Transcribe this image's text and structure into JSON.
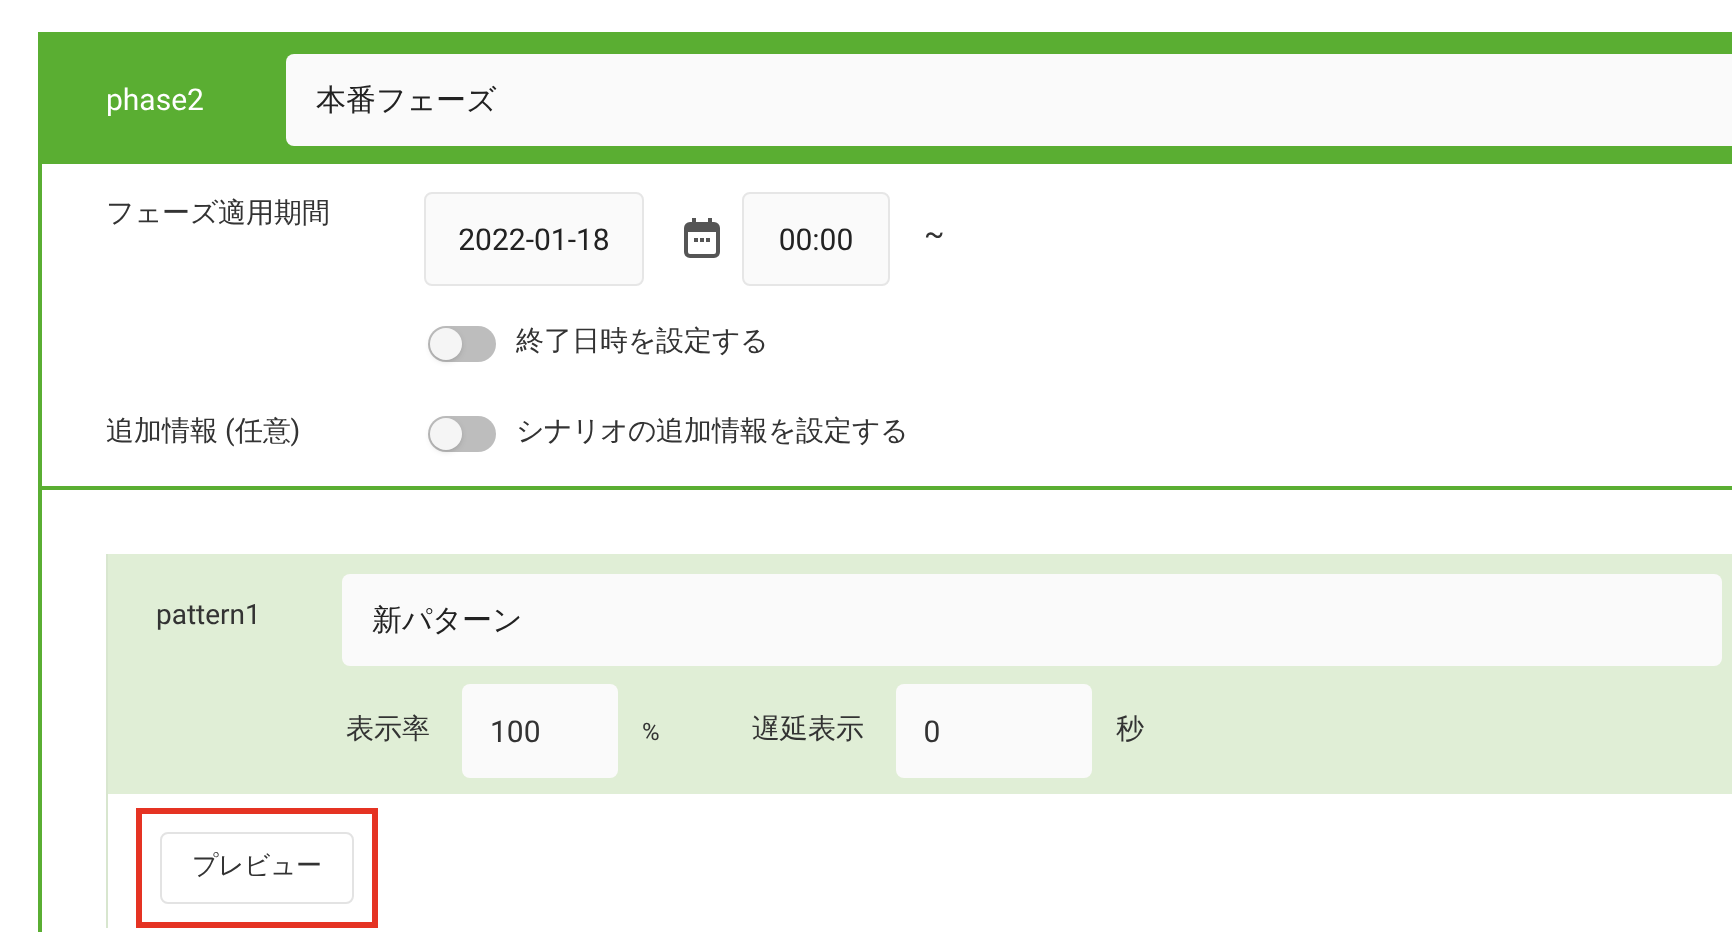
{
  "phase": {
    "label": "phase2",
    "name": "本番フェーズ"
  },
  "period": {
    "label": "フェーズ適用期間",
    "date": "2022-01-18",
    "time": "00:00",
    "separator": "~"
  },
  "toggles": [
    {
      "label": "終了日時を設定する",
      "on": false
    },
    {
      "label": "シナリオの追加情報を設定する",
      "on": false,
      "row_label": "追加情報 (任意)"
    }
  ],
  "pattern": {
    "label": "pattern1",
    "name": "新パターン",
    "rate_label": "表示率",
    "rate": "100",
    "rate_unit": "%",
    "delay_label": "遅延表示",
    "delay": "0",
    "delay_unit": "秒",
    "preview_button": "プレビュー",
    "preview_highlighted": true
  }
}
